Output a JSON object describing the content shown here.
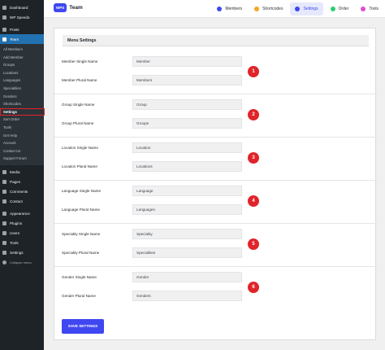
{
  "sidebar": {
    "top_items": [
      {
        "label": "Dashboard",
        "icon": "dashboard-icon"
      },
      {
        "label": "WP Speedo",
        "icon": "speedo-icon"
      }
    ],
    "items_before_team": [
      {
        "label": "Posts",
        "icon": "pin-icon"
      }
    ],
    "team": {
      "label": "Team",
      "icon": "team-icon"
    },
    "team_submenu": [
      "All Members",
      "Add Member",
      "Groups",
      "Locations",
      "Languages",
      "Specialities",
      "Genders",
      "Shortcodes",
      "Settings",
      "Sort Order",
      "Tools",
      "Get Help",
      "Account",
      "Contact Us",
      "Support Forum"
    ],
    "items_after_team": [
      {
        "label": "Media",
        "icon": "media-icon"
      },
      {
        "label": "Pages",
        "icon": "pages-icon"
      },
      {
        "label": "Comments",
        "icon": "comments-icon"
      },
      {
        "label": "Contact",
        "icon": "mail-icon"
      }
    ],
    "items_bottom": [
      {
        "label": "Appearance",
        "icon": "brush-icon"
      },
      {
        "label": "Plugins",
        "icon": "plugin-icon"
      },
      {
        "label": "Users",
        "icon": "users-icon"
      },
      {
        "label": "Tools",
        "icon": "wrench-icon"
      },
      {
        "label": "Settings",
        "icon": "settings-icon"
      }
    ],
    "collapse_label": "Collapse menu"
  },
  "header": {
    "logo_badge": "WPS",
    "logo_text": "Team",
    "nav": [
      {
        "label": "Members",
        "color": "#3f47f1",
        "active": false
      },
      {
        "label": "Shortcodes",
        "color": "#f5a623",
        "active": false
      },
      {
        "label": "Settings",
        "color": "#3f47f1",
        "active": true
      },
      {
        "label": "Order",
        "color": "#2ecc71",
        "active": false
      },
      {
        "label": "Tools",
        "color": "#e04bd0",
        "active": false
      }
    ]
  },
  "panel": {
    "title": "Menu Settings",
    "groups": [
      {
        "badge": "1",
        "single_label": "Member Single Name",
        "single_value": "Member",
        "plural_label": "Member Plural Name",
        "plural_value": "Members"
      },
      {
        "badge": "2",
        "single_label": "Group Single Name",
        "single_value": "Group",
        "plural_label": "Group Plural Name",
        "plural_value": "Groups"
      },
      {
        "badge": "3",
        "single_label": "Location Single Name",
        "single_value": "Location",
        "plural_label": "Location Plural Name",
        "plural_value": "Locations"
      },
      {
        "badge": "4",
        "single_label": "Language Single Name",
        "single_value": "Language",
        "plural_label": "Language Plural Name",
        "plural_value": "Languages"
      },
      {
        "badge": "5",
        "single_label": "Speciality Single Name",
        "single_value": "Speciality",
        "plural_label": "Speciality Plural Name",
        "plural_value": "Specialities"
      },
      {
        "badge": "6",
        "single_label": "Gender Single Name",
        "single_value": "Gender",
        "plural_label": "Gender Plural Name",
        "plural_value": "Genders"
      }
    ],
    "save_label": "SAVE SETTINGS"
  },
  "colors": {
    "accent": "#3f47f1",
    "badge": "#e0242a",
    "sidebar_bg": "#1d2327",
    "sidebar_active": "#2271b1"
  }
}
